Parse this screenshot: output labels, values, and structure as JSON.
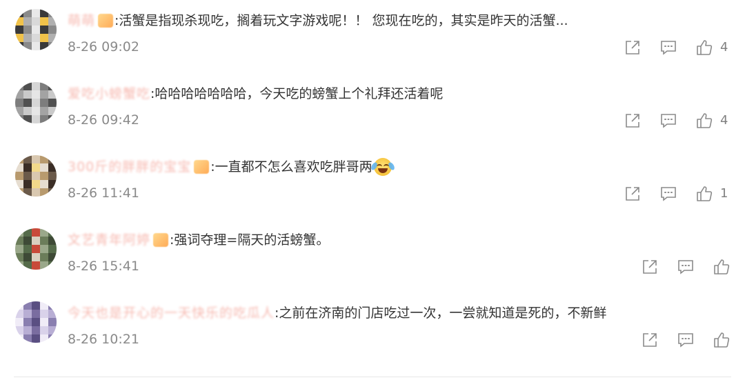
{
  "comments": [
    {
      "username": "萌萌",
      "text": ":活蟹是指现杀现吃，搁着玩文字游戏呢！！ 您现在吃的，其实是昨天的活蟹...",
      "time": "8-26 09:02",
      "likes": "4",
      "avatar_colors": [
        "#3a3a3a",
        "#d9d9d9",
        "#8a8a8a",
        "#f0c24a",
        "#e9e9e9",
        "#b0b0b0"
      ]
    },
    {
      "username": "爱吃小螃蟹吃",
      "text": ":哈哈哈哈哈哈哈，今天吃的螃蟹上个礼拜还活着呢",
      "time": "8-26 09:42",
      "likes": "4",
      "avatar_colors": [
        "#c9c9c9",
        "#7d7d7d",
        "#e6e6e6",
        "#505050",
        "#a3a3a3",
        "#d6d6d6"
      ]
    },
    {
      "username": "300斤的胖胖的宝宝",
      "text": ":一直都不怎么喜欢吃胖哥两",
      "time": "8-26 11:41",
      "likes": "1",
      "avatar_colors": [
        "#d9c8b0",
        "#3b2e26",
        "#b89a6e",
        "#f2d98a",
        "#6b5a4a",
        "#e6ddd0"
      ]
    },
    {
      "username": "文艺青年阿婷",
      "text": ":强词夺理=隔天的活螃蟹。",
      "time": "8-26 15:41",
      "likes": "",
      "avatar_colors": [
        "#6b7d5a",
        "#c84a3a",
        "#3e4a36",
        "#9aa88a",
        "#d9d0c0",
        "#556b4a"
      ]
    },
    {
      "username": "今天也是开心的一天快乐的吃瓜人",
      "text": ":之前在济南的门店吃过一次，一尝就知道是死的，不新鲜",
      "time": "8-26 10:21",
      "likes": "",
      "avatar_colors": [
        "#8a7fb0",
        "#d9d2ea",
        "#5a4f82",
        "#b8aed4",
        "#f0ecf7",
        "#7a6da0"
      ]
    }
  ],
  "icons": {
    "share": "share-icon",
    "comment": "comment-icon",
    "like": "like-icon"
  }
}
